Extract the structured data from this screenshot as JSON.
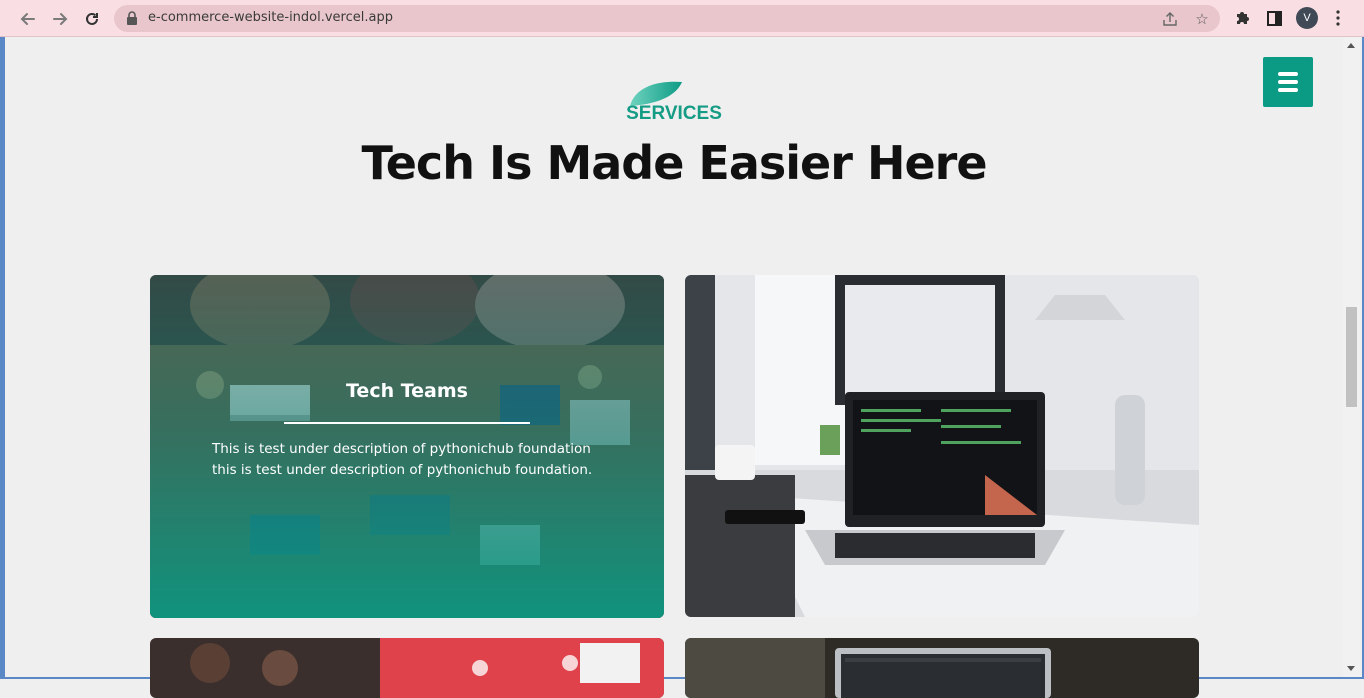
{
  "browser": {
    "url": "e-commerce-website-indol.vercel.app",
    "profile_initial": "V",
    "icons": [
      "back-arrow-icon",
      "forward-arrow-icon",
      "reload-icon",
      "lock-icon",
      "share-icon",
      "star-icon",
      "extensions-puzzle-icon",
      "side-panel-icon",
      "more-vert-icon"
    ]
  },
  "header": {
    "menu_icon": "hamburger-menu-icon",
    "accent_color": "#0b9a84"
  },
  "section": {
    "eyebrow": "SERVICES",
    "title": "Tech Is Made Easier Here"
  },
  "cards": [
    {
      "title": "Tech Teams",
      "description": "This is test under description of pythonichub foundation this is test under description of pythonichub foundation.",
      "image": "team-at-desk-photo"
    },
    {
      "image": "laptop-on-desk-photo"
    },
    {
      "image": "red-decor-photo"
    },
    {
      "image": "laptop-dark-photo"
    }
  ]
}
